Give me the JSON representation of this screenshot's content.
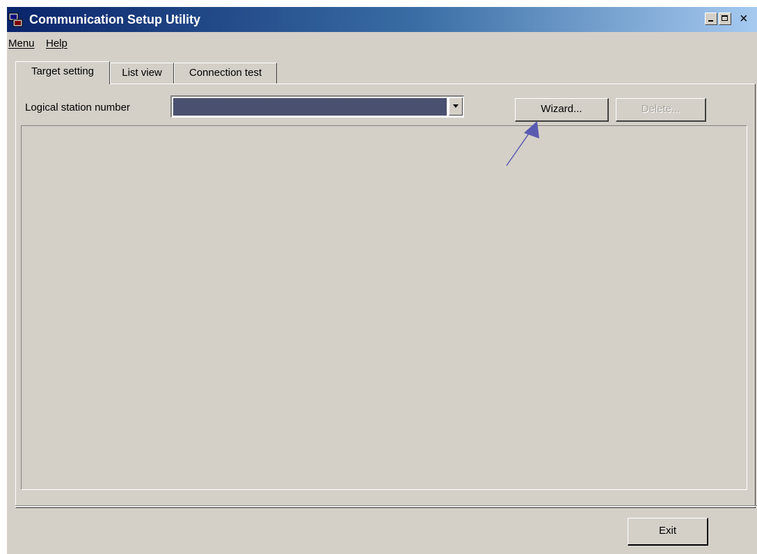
{
  "window": {
    "title": "Communication Setup Utility",
    "controls": [
      "minimize-icon",
      "maximize-icon",
      "close-icon"
    ],
    "close_glyph": "×"
  },
  "menubar": {
    "items": [
      {
        "label": "Menu"
      },
      {
        "label": "Help"
      }
    ]
  },
  "tabs": [
    {
      "label": "Target setting",
      "active": true
    },
    {
      "label": "List view",
      "active": false
    },
    {
      "label": "Connection test",
      "active": false
    }
  ],
  "target_setting": {
    "logical_station_label": "Logical station number",
    "logical_station_value": "",
    "wizard_label": "Wizard...",
    "delete_label": "Delete...",
    "delete_enabled": false
  },
  "footer": {
    "exit_label": "Exit"
  },
  "colors": {
    "face": "#d4d0c8",
    "title_start": "#0a246a",
    "title_end": "#a6caf0",
    "selection": "#4a5070",
    "annotation_arrow": "#5a5ab0"
  }
}
